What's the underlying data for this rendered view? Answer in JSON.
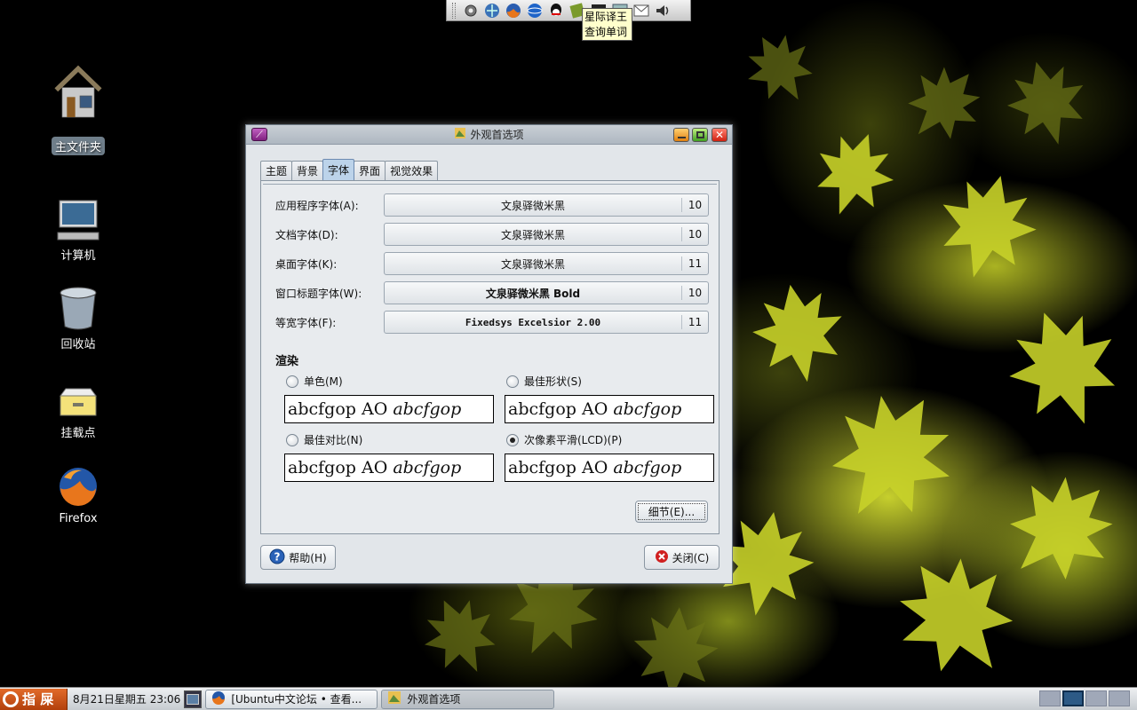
{
  "top_panel": {
    "icons": [
      "settings-icon",
      "network-icon",
      "firefox-icon",
      "globe-icon",
      "qq-icon",
      "dictionary-icon",
      "terminal-icon",
      "screenshot-icon",
      "mail-icon",
      "volume-icon"
    ],
    "tooltip_line1": "星际译王",
    "tooltip_line2": "查询单词"
  },
  "desktop": {
    "icons": [
      {
        "label": "主文件夹",
        "icon": "home-folder-icon"
      },
      {
        "label": "计算机",
        "icon": "computer-icon"
      },
      {
        "label": "回收站",
        "icon": "trash-icon"
      },
      {
        "label": "挂载点",
        "icon": "drive-icon"
      },
      {
        "label": "Firefox",
        "icon": "firefox-icon"
      }
    ]
  },
  "window": {
    "title": "外观首选项",
    "tabs": [
      {
        "label": "主题"
      },
      {
        "label": "背景"
      },
      {
        "label": "字体"
      },
      {
        "label": "界面"
      },
      {
        "label": "视觉效果"
      }
    ],
    "active_tab": "字体",
    "font_rows": [
      {
        "label": "应用程序字体(A):",
        "font": "文泉驿微米黑",
        "size": "10"
      },
      {
        "label": "文档字体(D):",
        "font": "文泉驿微米黑",
        "size": "10"
      },
      {
        "label": "桌面字体(K):",
        "font": "文泉驿微米黑",
        "size": "11"
      },
      {
        "label": "窗口标题字体(W):",
        "font": "文泉驿微米黑 Bold",
        "size": "10"
      },
      {
        "label": "等宽字体(F):",
        "font": "Fixedsys Excelsior 2.00",
        "size": "11"
      }
    ],
    "rendering": {
      "title": "渲染",
      "options": [
        {
          "label": "单色(M)",
          "checked": false
        },
        {
          "label": "最佳形状(S)",
          "checked": false
        },
        {
          "label": "最佳对比(N)",
          "checked": false
        },
        {
          "label": "次像素平滑(LCD)(P)",
          "checked": true
        }
      ],
      "sample_regular": "abcfgop AO",
      "sample_italic": "abcfgop"
    },
    "details_button": "细节(E)...",
    "help_button": "帮助(H)",
    "close_button": "关闭(C)"
  },
  "bottom_panel": {
    "start_label": "指 屎",
    "clock": "8月21日星期五 23:06",
    "tasks": [
      {
        "label": "[Ubuntu中文论坛 • 查看...",
        "icon": "firefox-icon",
        "active": false
      },
      {
        "label": "外观首选项",
        "icon": "appearance-icon",
        "active": true
      }
    ],
    "workspaces": 4,
    "current_workspace": 2
  }
}
